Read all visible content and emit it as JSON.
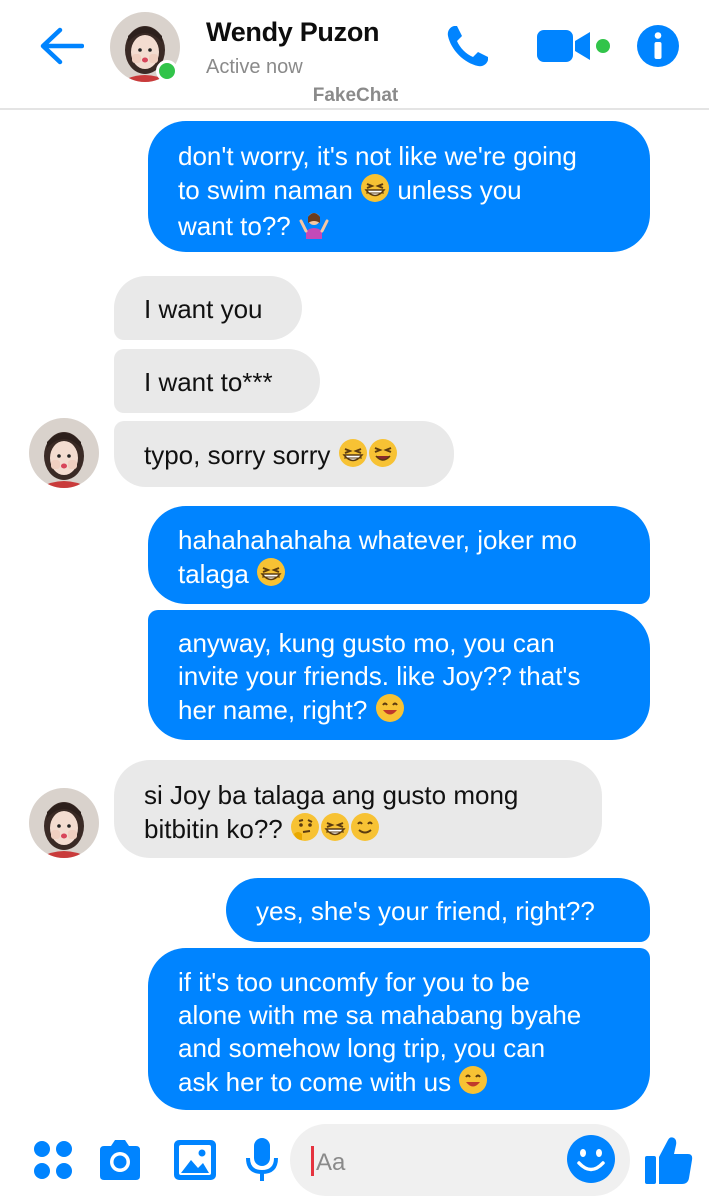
{
  "header": {
    "name": "Wendy Puzon",
    "status": "Active now",
    "app_label": "FakeChat"
  },
  "icons": {
    "back": "back-arrow-icon",
    "call": "phone-icon",
    "video": "video-camera-icon",
    "info": "info-icon",
    "apps": "apps-grid-icon",
    "camera": "camera-icon",
    "gallery": "image-icon",
    "mic": "microphone-icon",
    "emoji": "smiley-icon",
    "like": "thumbs-up-icon"
  },
  "colors": {
    "accent": "#0084ff",
    "incoming_bubble": "#e9e9e9",
    "presence": "#31c44a"
  },
  "messages": [
    {
      "dir": "out",
      "lines": [
        "don't worry, it's not like we're going",
        "to swim naman",
        "unless you",
        "want to??"
      ]
    },
    {
      "dir": "in",
      "lines": [
        "I want you"
      ]
    },
    {
      "dir": "in",
      "lines": [
        "I want to***"
      ]
    },
    {
      "dir": "in",
      "lines": [
        "typo, sorry sorry"
      ]
    },
    {
      "dir": "out",
      "lines": [
        "hahahahahaha whatever, joker mo",
        "talaga"
      ]
    },
    {
      "dir": "out",
      "lines": [
        "anyway, kung gusto mo, you can",
        "invite your friends. like Joy?? that's",
        "her name, right?"
      ]
    },
    {
      "dir": "in",
      "lines": [
        "si Joy ba talaga ang gusto mong",
        "bitbitin ko??"
      ]
    },
    {
      "dir": "out",
      "lines": [
        "yes, she's your friend, right??"
      ]
    },
    {
      "dir": "out",
      "lines": [
        "if it's too uncomfy for you to be",
        "alone with me sa mahabang byahe",
        "and somehow long trip, you can",
        "ask her to come with us"
      ]
    }
  ],
  "composer": {
    "placeholder": "Aa"
  }
}
